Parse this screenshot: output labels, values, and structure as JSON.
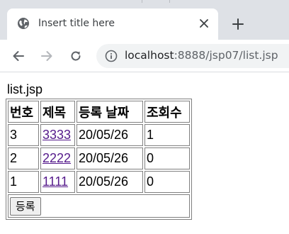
{
  "browser": {
    "tab": {
      "title": "Insert title here",
      "favicon": "globe-icon",
      "close_icon": "close-icon"
    },
    "new_tab_icon": "plus-icon",
    "nav": {
      "back_icon": "back-arrow-icon",
      "forward_icon": "forward-arrow-icon",
      "reload_icon": "reload-icon"
    },
    "address_bar": {
      "info_icon": "info-icon",
      "host": "localhost",
      "port_path": ":8888/jsp07/list.jsp"
    }
  },
  "page": {
    "heading": "list.jsp",
    "table": {
      "headers": [
        "번호",
        "제목",
        "등록 날짜",
        "조회수"
      ],
      "rows": [
        {
          "no": "3",
          "title": "3333",
          "date": "20/05/26",
          "views": "1"
        },
        {
          "no": "2",
          "title": "2222",
          "date": "20/05/26",
          "views": "0"
        },
        {
          "no": "1",
          "title": "1111",
          "date": "20/05/26",
          "views": "0"
        }
      ]
    },
    "register_button": "등록"
  },
  "colors": {
    "tabstrip": "#dee1e6",
    "omnibox": "#f1f3f4",
    "visited_link": "#551a8b",
    "table_border": "#808080"
  }
}
